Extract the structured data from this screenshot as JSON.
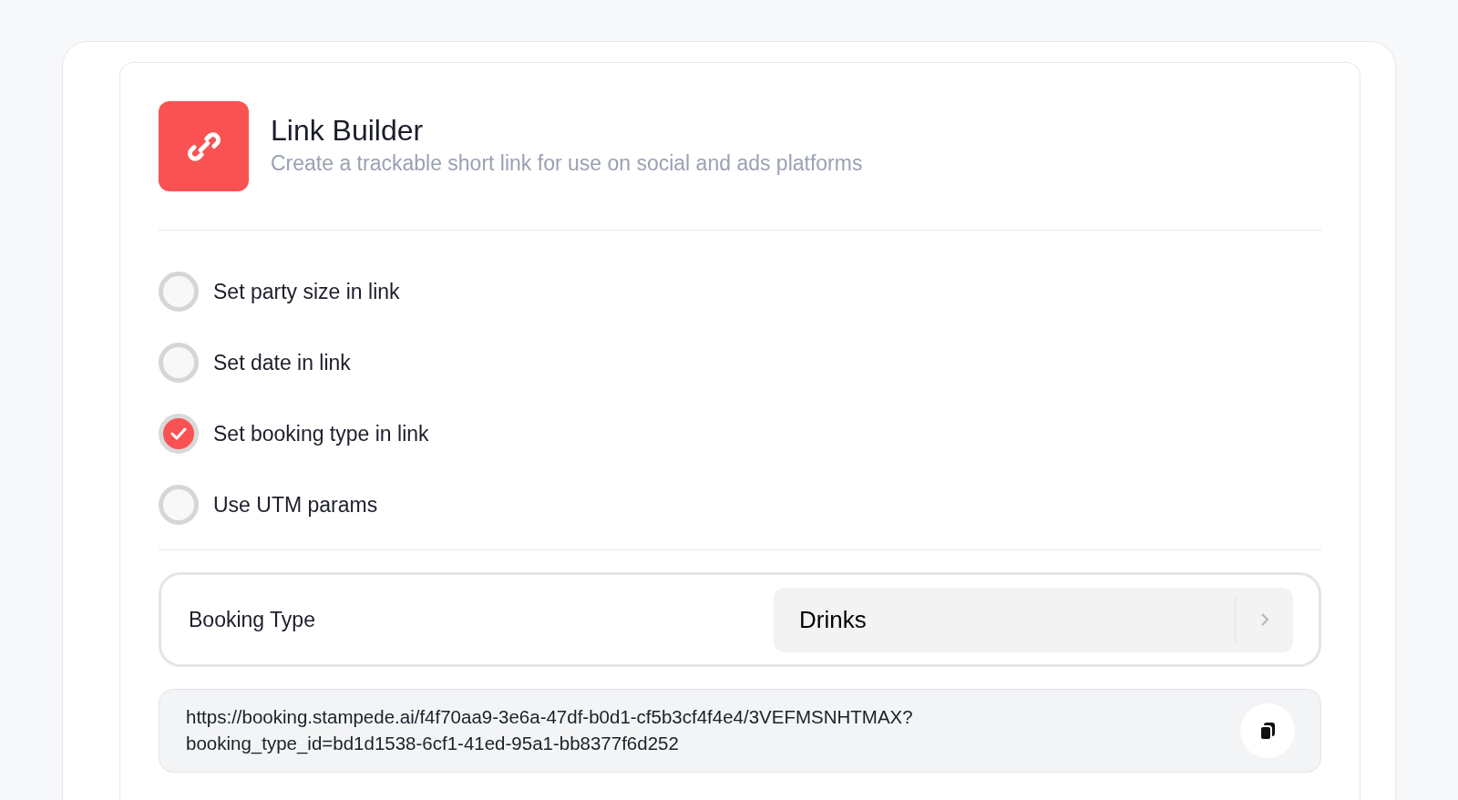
{
  "header": {
    "title": "Link Builder",
    "subtitle": "Create a trackable short link for use on social and ads platforms"
  },
  "options": [
    {
      "label": "Set party size in link",
      "checked": false
    },
    {
      "label": "Set date in link",
      "checked": false
    },
    {
      "label": "Set booking type in link",
      "checked": true
    },
    {
      "label": "Use UTM params",
      "checked": false
    }
  ],
  "booking_type": {
    "label": "Booking Type",
    "value": "Drinks"
  },
  "link": {
    "url": "https://booking.stampede.ai/f4f70aa9-3e6a-47df-b0d1-cf5b3cf4f4e4/3VEFMSNHTMAX?booking_type_id=bd1d1538-6cf1-41ed-95a1-bb8377f6d252"
  }
}
